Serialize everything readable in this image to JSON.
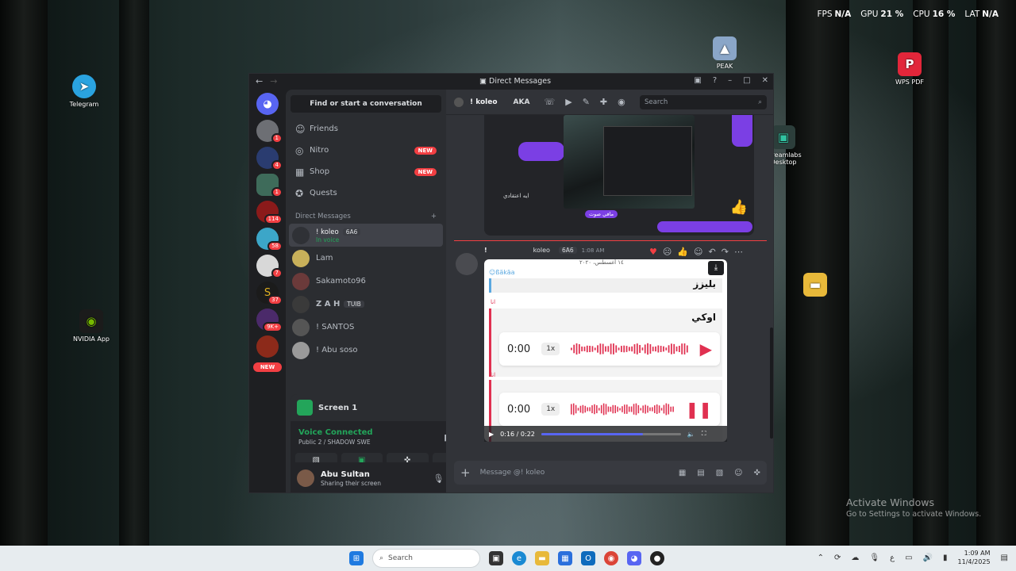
{
  "hud": {
    "fps_label": "FPS",
    "fps": "N/A",
    "gpu_label": "GPU",
    "gpu": "21 %",
    "cpu_label": "CPU",
    "cpu": "16 %",
    "lat_label": "LAT",
    "lat": "N/A"
  },
  "desktop": {
    "icons": [
      "Telegram",
      "PEAK",
      "WPS PDF",
      "NVIDIA App",
      "Streamlabs Desktop"
    ],
    "activate_title": "Activate Windows",
    "activate_sub": "Go to Settings to activate Windows."
  },
  "window": {
    "title": "Direct Messages"
  },
  "guilds": {
    "badges": [
      "1",
      "4",
      "1",
      "114",
      "58",
      "7",
      "37",
      "9K+"
    ],
    "new_label": "NEW"
  },
  "sidebar": {
    "find": "Find or start a conversation",
    "nav": [
      {
        "label": "Friends",
        "icon": "friends-icon"
      },
      {
        "label": "Nitro",
        "icon": "nitro-icon",
        "tag": "NEW"
      },
      {
        "label": "Shop",
        "icon": "shop-icon",
        "tag": "NEW"
      },
      {
        "label": "Quests",
        "icon": "quests-icon"
      }
    ],
    "dm_header": "Direct Messages",
    "dms": [
      {
        "name": "! koleo",
        "tag": "6A6",
        "sub": "In voice"
      },
      {
        "name": "Lam"
      },
      {
        "name": "Sakamoto96"
      },
      {
        "name": "Z A H",
        "tag": "TUIB"
      },
      {
        "name": "! SANTOS"
      },
      {
        "name": "! Abu soso"
      }
    ]
  },
  "panel": {
    "screen_title": "Screen 1",
    "voice_status": "Voice Connected",
    "voice_channel": "Public 2 / SHADOW SWE",
    "username": "Abu Sultan",
    "user_status": "Sharing their screen"
  },
  "chat": {
    "channel_name": "! koleo",
    "aka": "AKA",
    "search_placeholder": "Search",
    "old_text": "ايه اعتقادي",
    "old_label": "مافي صوت",
    "msg_bang": "!",
    "msg_author": "koleo",
    "msg_tag": "6A6",
    "msg_time": "1:08 AM",
    "card": {
      "date": "١٤ أغسطس، ٢٠٢٠",
      "nick": "☺ßäkäa",
      "quote": "بليزز",
      "ana1": "انا",
      "reply": "اوكي",
      "ana2": "انا",
      "audio1_time": "0:00",
      "audio1_speed": "1x",
      "audio2_time": "0:00",
      "audio2_speed": "1x"
    },
    "video_time": "0:16 / 0:22",
    "video_progress": 0.73,
    "composer_placeholder": "Message @! koleo"
  },
  "taskbar": {
    "search": "Search",
    "time": "1:09 AM",
    "date": "11/4/2025"
  }
}
